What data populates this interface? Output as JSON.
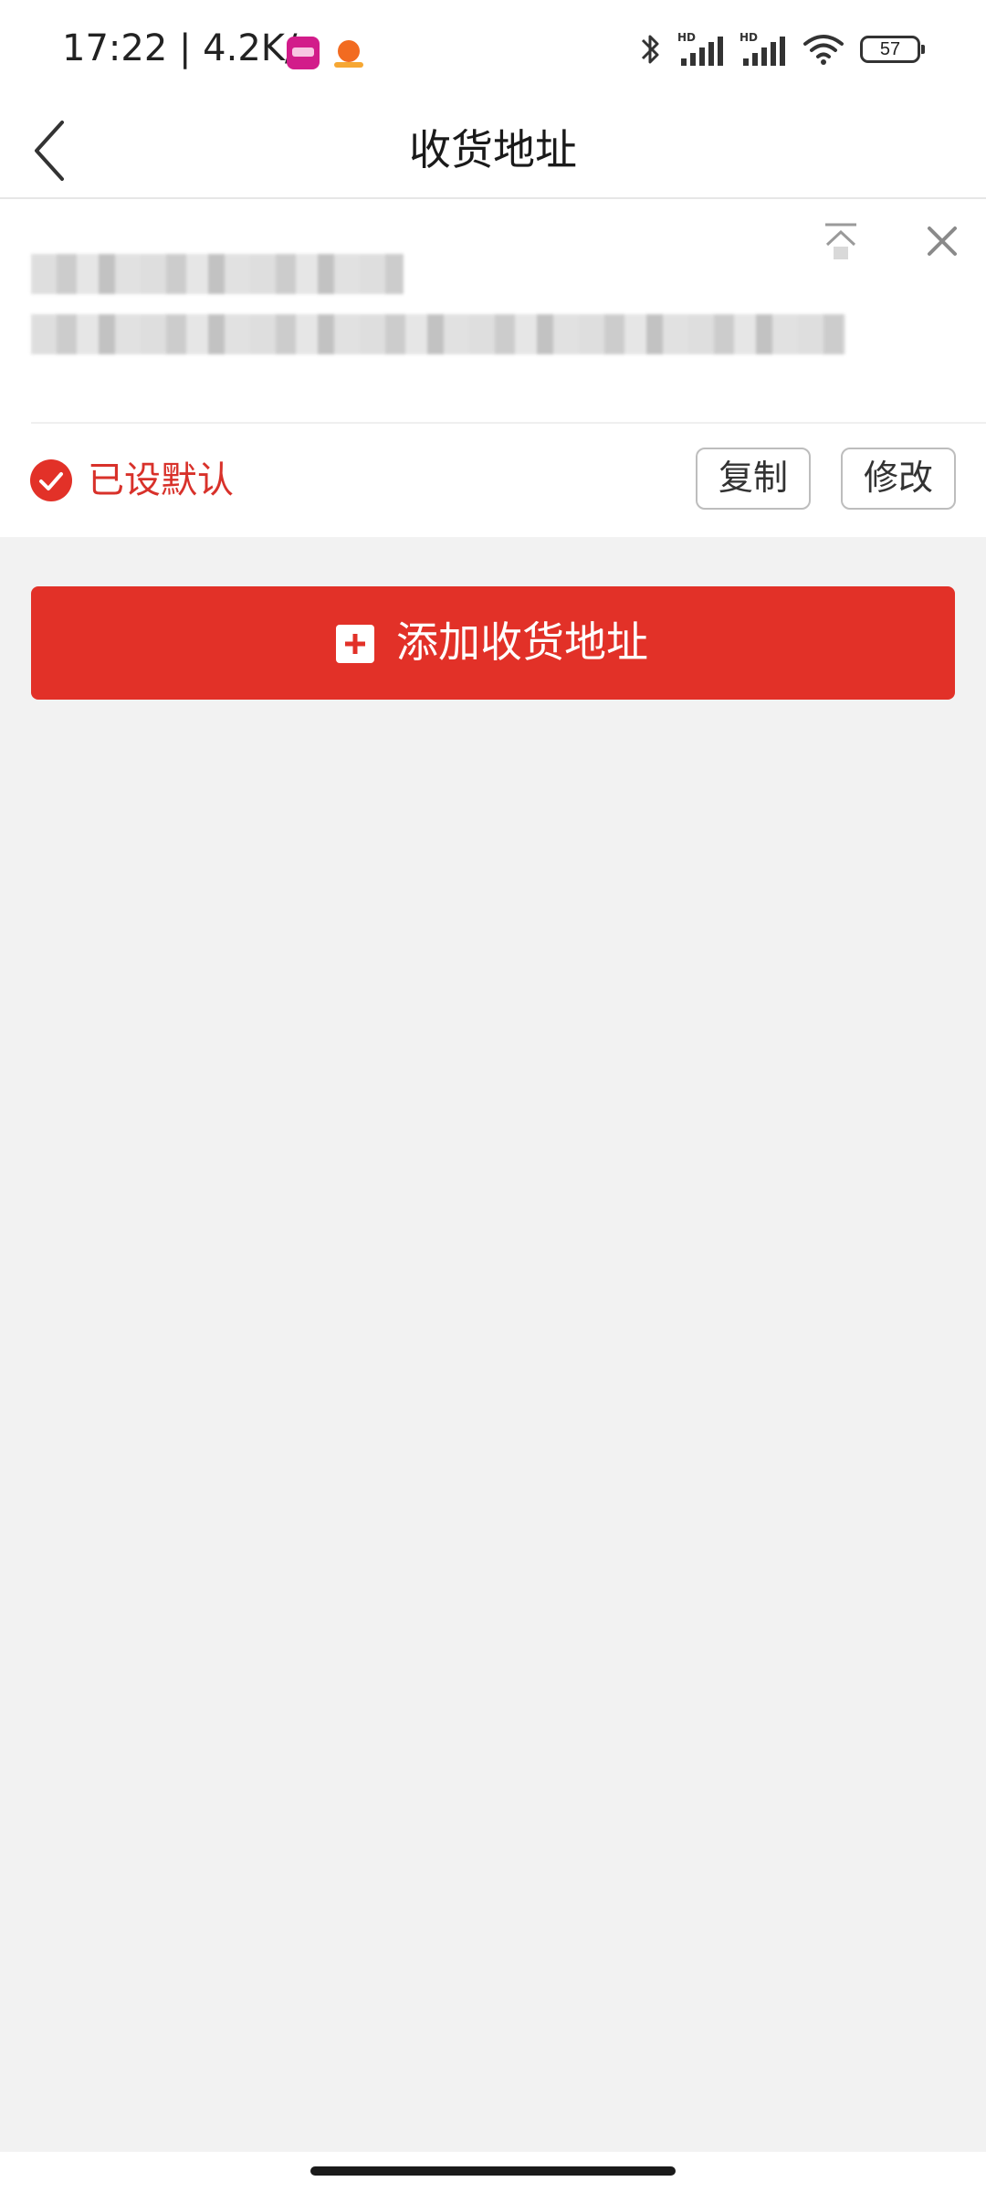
{
  "status_bar": {
    "time": "17:22 | 4.2K/s",
    "battery": "57",
    "icons": [
      "vip-app-icon",
      "orange-app-icon",
      "bluetooth-icon",
      "hd-signal-icon",
      "hd-signal-icon",
      "wifi-icon",
      "battery-icon"
    ]
  },
  "header": {
    "title": "收货地址",
    "back_icon": "chevron-left-icon"
  },
  "address_card": {
    "pin_icon": "pin-to-top-icon",
    "close_icon": "close-icon",
    "default_label": "已设默认",
    "copy_label": "复制",
    "edit_label": "修改",
    "check_color": "#e23128"
  },
  "add_button": {
    "label": "添加收货地址",
    "icon": "plus-square-icon",
    "color": "#e23128"
  }
}
